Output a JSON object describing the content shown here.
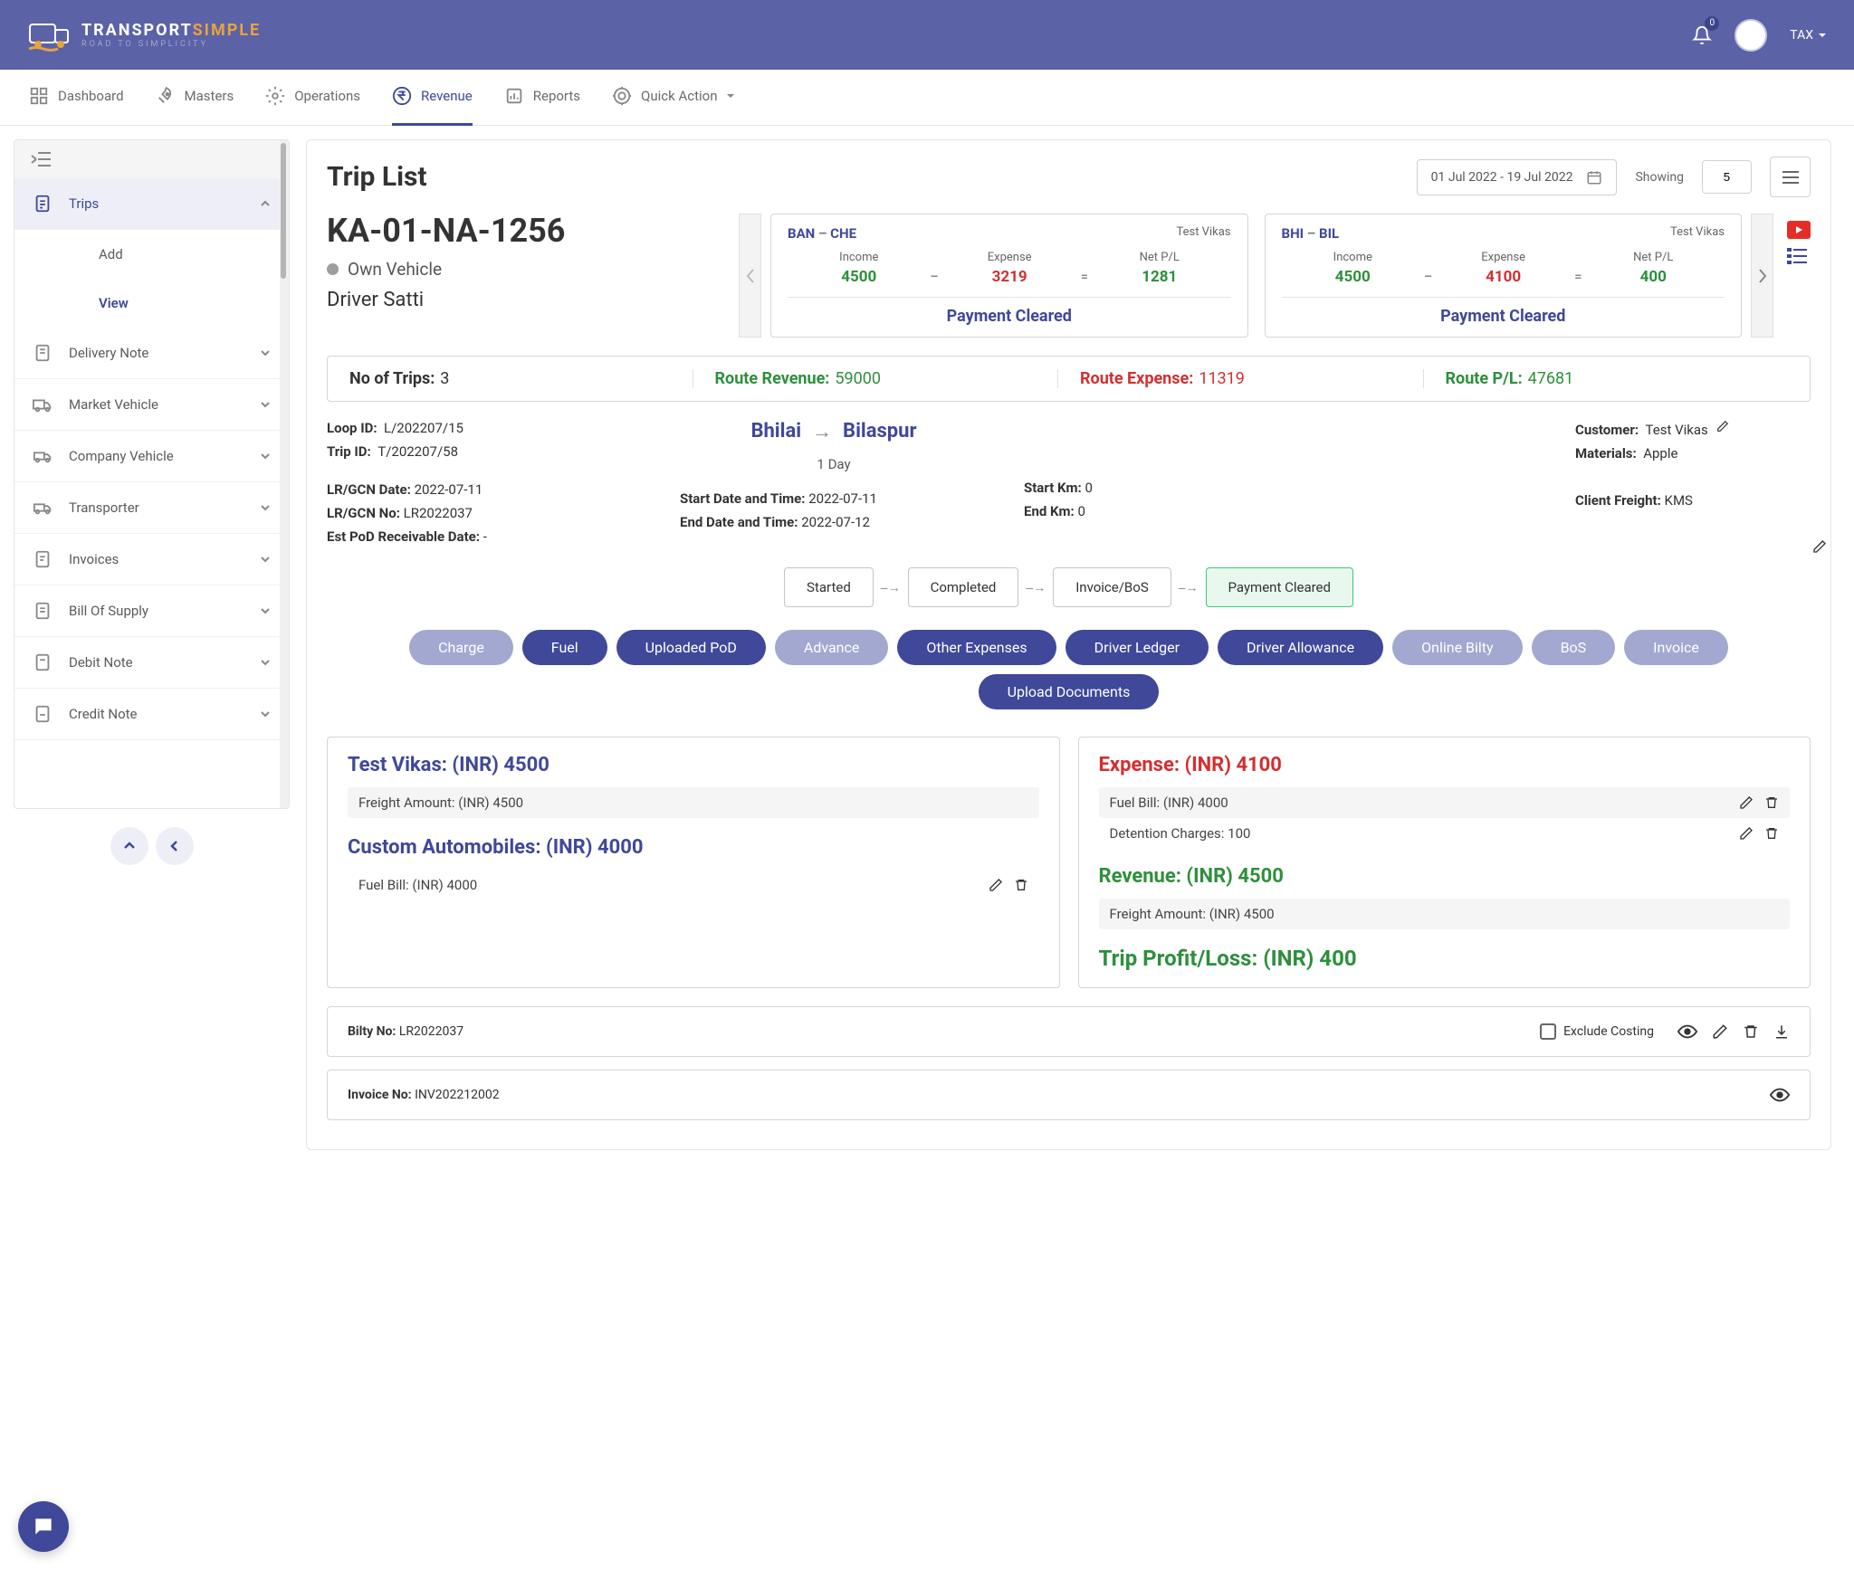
{
  "brand": {
    "left": "TRANSPORT",
    "right": "SIMPLE",
    "tagline": "ROAD TO SIMPLICITY"
  },
  "header": {
    "notifications": "0",
    "user": "TAX"
  },
  "nav": [
    "Dashboard",
    "Masters",
    "Operations",
    "Revenue",
    "Reports",
    "Quick Action"
  ],
  "sidebar": {
    "items": [
      {
        "label": "Trips"
      },
      {
        "label": "Delivery Note"
      },
      {
        "label": "Market Vehicle"
      },
      {
        "label": "Company Vehicle"
      },
      {
        "label": "Transporter"
      },
      {
        "label": "Invoices"
      },
      {
        "label": "Bill Of Supply"
      },
      {
        "label": "Debit Note"
      },
      {
        "label": "Credit Note"
      }
    ],
    "sub": {
      "add": "Add",
      "view": "View"
    }
  },
  "page": {
    "title": "Trip List",
    "date_range": "01 Jul 2022 - 19 Jul 2022",
    "showing_label": "Showing",
    "showing_value": "5"
  },
  "vehicle": {
    "no": "KA-01-NA-1256",
    "type": "Own Vehicle",
    "driver": "Driver Satti"
  },
  "trip_cards": [
    {
      "from": "BAN",
      "to": "CHE",
      "customer": "Test Vikas",
      "income_label": "Income",
      "income": "4500",
      "expense_label": "Expense",
      "expense": "3219",
      "pl_label": "Net P/L",
      "pl": "1281",
      "status": "Payment Cleared"
    },
    {
      "from": "BHI",
      "to": "BIL",
      "customer": "Test Vikas",
      "income_label": "Income",
      "income": "4500",
      "expense_label": "Expense",
      "expense": "4100",
      "pl_label": "Net P/L",
      "pl": "400",
      "status": "Payment Cleared"
    }
  ],
  "summary": {
    "trips_label": "No of Trips:",
    "trips": "3",
    "revenue_label": "Route Revenue:",
    "revenue": "59000",
    "expense_label": "Route Expense:",
    "expense": "11319",
    "pl_label": "Route P/L:",
    "pl": "47681"
  },
  "details": {
    "loop_id_label": "Loop ID:",
    "loop_id": "L/202207/15",
    "trip_id_label": "Trip ID:",
    "trip_id": "T/202207/58",
    "lr_date_label": "LR/GCN Date:",
    "lr_date": "2022-07-11",
    "lr_no_label": "LR/GCN No:",
    "lr_no": "LR2022037",
    "est_pod_label": "Est PoD Receivable Date:",
    "est_pod": "-",
    "start_dt_label": "Start Date and Time:",
    "start_dt": "2022-07-11",
    "end_dt_label": "End Date and Time:",
    "end_dt": "2022-07-12",
    "start_km_label": "Start Km:",
    "start_km": "0",
    "end_km_label": "End Km:",
    "end_km": "0",
    "route_from": "Bhilai",
    "route_to": "Bilaspur",
    "duration": "1 Day",
    "customer_label": "Customer:",
    "customer": "Test Vikas",
    "materials_label": "Materials:",
    "materials": "Apple",
    "freight_label": "Client Freight:",
    "freight": "KMS"
  },
  "flow": [
    "Started",
    "Completed",
    "Invoice/BoS",
    "Payment Cleared"
  ],
  "pills_row1": [
    "Charge",
    "Fuel",
    "Uploaded PoD",
    "Advance",
    "Other Expenses",
    "Driver Ledger",
    "Driver Allowance"
  ],
  "pills_row2": [
    "Online Bilty",
    "BoS",
    "Invoice",
    "Upload Documents"
  ],
  "left_box": {
    "h1": "Test Vikas: (INR) 4500",
    "l1": "Freight Amount: (INR) 4500",
    "h2": "Custom Automobiles: (INR) 4000",
    "l2": "Fuel Bill: (INR) 4000"
  },
  "right_box": {
    "exp_title": "Expense: (INR) 4100",
    "exp1": "Fuel Bill: (INR) 4000",
    "exp2": "Detention Charges: 100",
    "rev_title": "Revenue: (INR) 4500",
    "rev1": "Freight Amount: (INR) 4500",
    "pl_title": "Trip Profit/Loss: (INR) 400"
  },
  "bilty": {
    "label": "Bilty No:",
    "value": "LR2022037",
    "exclude": "Exclude Costing"
  },
  "invoice": {
    "label": "Invoice No:",
    "value": "INV202212002"
  }
}
